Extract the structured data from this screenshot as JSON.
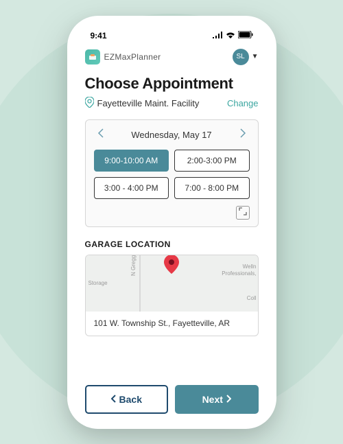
{
  "status_bar": {
    "time": "9:41"
  },
  "header": {
    "app_name": "EZMaxPlanner",
    "user_initials": "SL"
  },
  "page": {
    "title": "Choose Appointment",
    "location_name": "Fayetteville Maint. Facility",
    "change_label": "Change"
  },
  "date_picker": {
    "date_label": "Wednesday, May 17"
  },
  "slots": [
    {
      "label": "9:00-10:00 AM",
      "selected": true
    },
    {
      "label": "2:00-3:00 PM",
      "selected": false
    },
    {
      "label": "3:00 - 4:00 PM",
      "selected": false
    },
    {
      "label": "7:00 - 8:00 PM",
      "selected": false
    }
  ],
  "garage": {
    "section_label": "GARAGE LOCATION",
    "address": "101 W. Township St., Fayetteville, AR",
    "map_labels": {
      "street": "N Gregg Ave",
      "left": "Storage",
      "right1": "Welln",
      "right2": "Professionals,",
      "right3": "Coll"
    }
  },
  "footer": {
    "back_label": "Back",
    "next_label": "Next"
  }
}
